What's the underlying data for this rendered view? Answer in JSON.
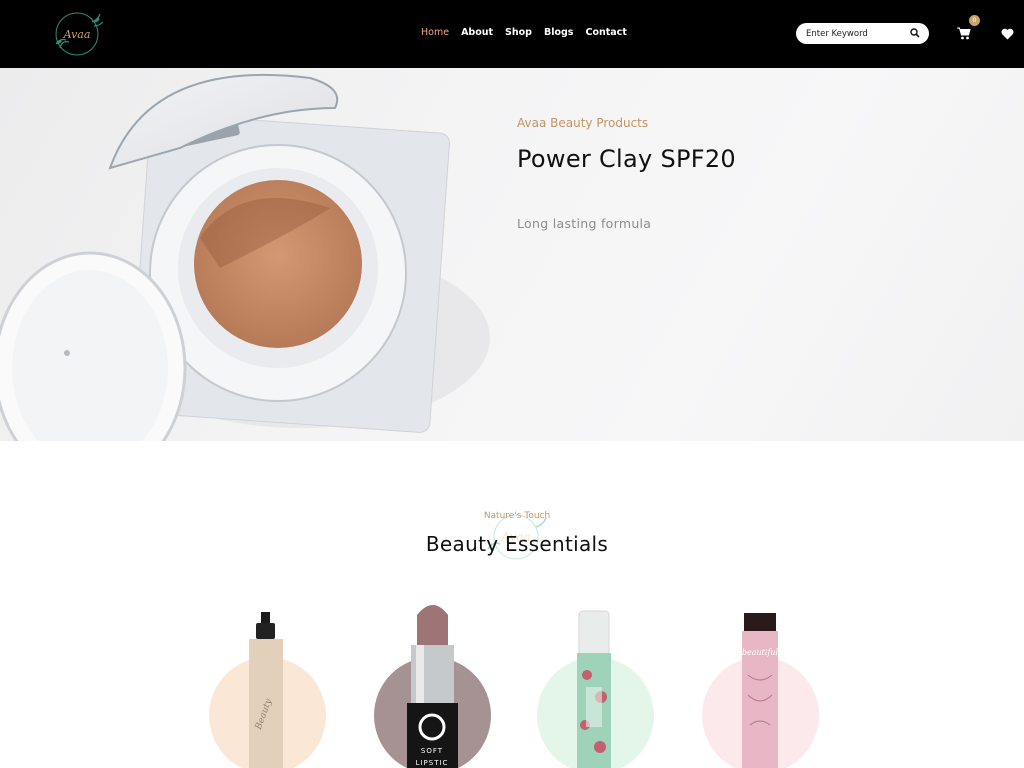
{
  "header": {
    "nav": [
      "Home",
      "About",
      "Shop",
      "Blogs",
      "Contact"
    ],
    "active_nav": "Home",
    "search_placeholder": "Enter Keyword",
    "cart_count": "0",
    "logo_text": "Avaa"
  },
  "hero": {
    "subtitle": "Avaa Beauty Products",
    "title": "Power Clay SPF20",
    "tagline": "Long lasting formula"
  },
  "section": {
    "kicker": "Nature's Touch",
    "title": "Beauty Essentials"
  },
  "products": [
    {
      "label": "Beauty",
      "circle_color": "#fbe7d6",
      "body_color": "#e5d3bf"
    },
    {
      "label": "SOFT LIPSTIC",
      "circle_color": "#a69292",
      "body_color": "#1a1a1a"
    },
    {
      "label": "",
      "circle_color": "#e4f6ea",
      "body_color": "#a8d8c0"
    },
    {
      "label": "beautiful",
      "circle_color": "#fbe9ec",
      "body_color": "#e9b9c8"
    }
  ],
  "colors": {
    "accent": "#c49560",
    "nav_active": "#f0a987"
  }
}
